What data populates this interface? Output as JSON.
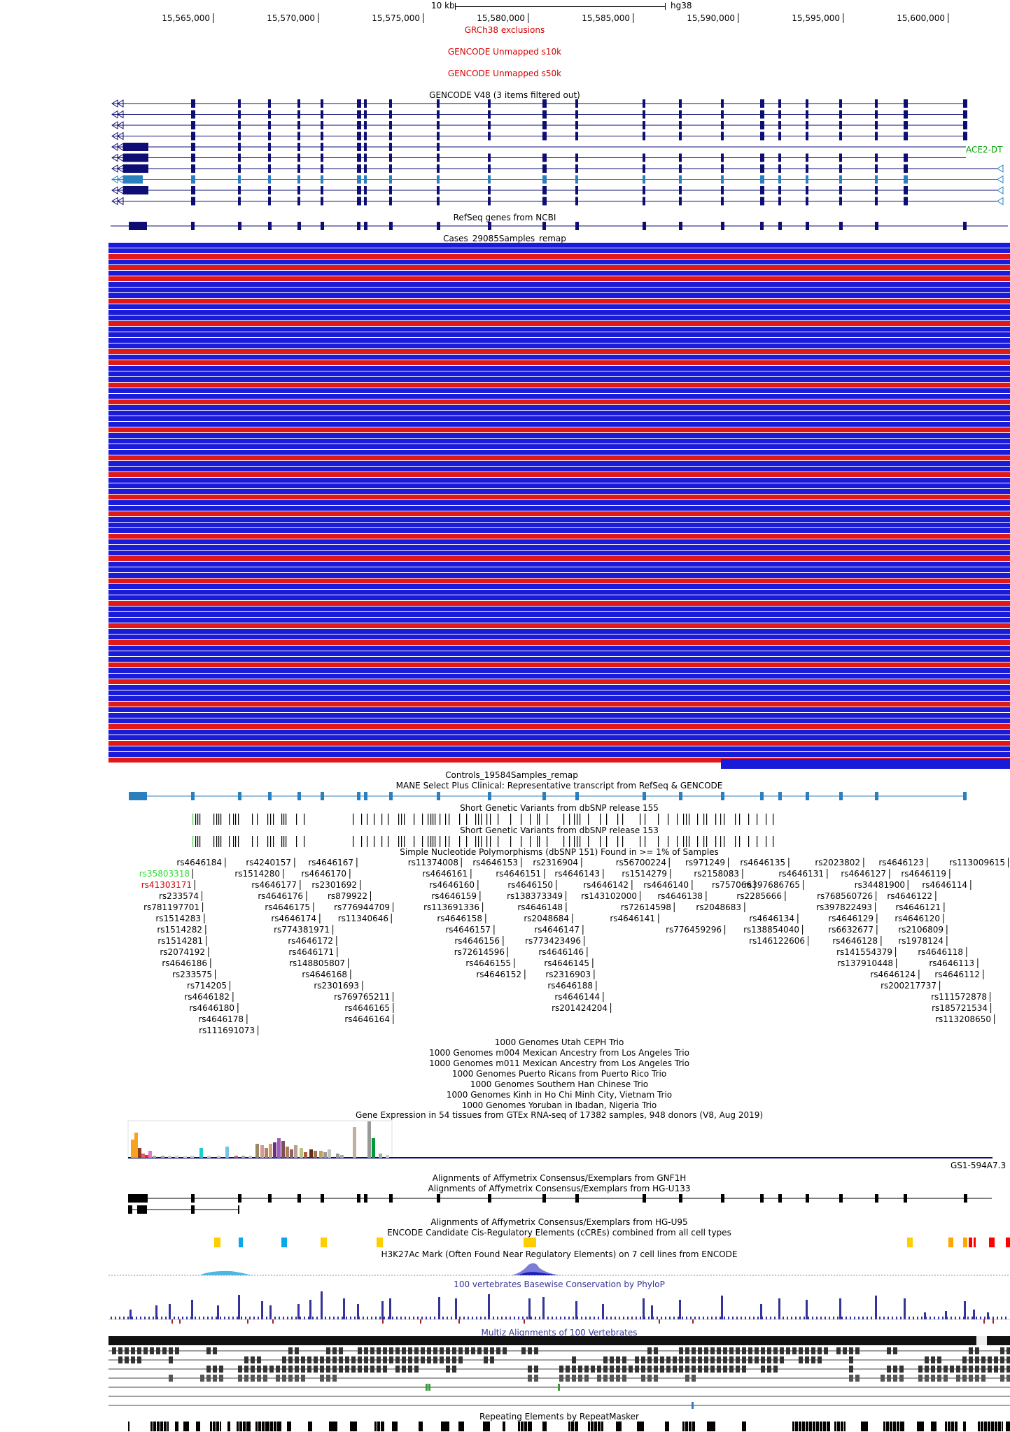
{
  "ruler": {
    "scale_label": "10 kb",
    "assembly": "hg38",
    "ticks": [
      "15,565,000",
      "15,570,000",
      "15,575,000",
      "15,580,000",
      "15,585,000",
      "15,590,000",
      "15,595,000",
      "15,600,000"
    ]
  },
  "tracks": {
    "grch38_exclusions": "GRCh38 exclusions",
    "unmapped_s10k": "GENCODE Unmapped s10k",
    "unmapped_s50k": "GENCODE Unmapped s50k",
    "gencode": "GENCODE V48 (3 items filtered out)",
    "gencode_side_label": "ACE2-DT",
    "refseq": "RefSeq genes from NCBI",
    "cases": "Cases_29085Samples_remap",
    "controls": "Controls_19584Samples_remap",
    "mane": "MANE Select Plus Clinical: Representative transcript from RefSeq & GENCODE",
    "dbsnp155": "Short Genetic Variants from dbSNP release 155",
    "dbsnp153": "Short Genetic Variants from dbSNP release 153",
    "snp151": "Simple Nucleotide Polymorphisms (dbSNP 151) Found in >= 1% of Samples",
    "trio_ceph": "1000 Genomes Utah CEPH Trio",
    "trio_m004": "1000 Genomes m004 Mexican Ancestry from Los Angeles Trio",
    "trio_m011": "1000 Genomes m011 Mexican Ancestry from Los Angeles Trio",
    "trio_pr": "1000 Genomes Puerto Ricans from Puerto Rico Trio",
    "trio_han": "1000 Genomes Southern Han Chinese Trio",
    "trio_kinh": "1000 Genomes Kinh in Ho Chi Minh City, Vietnam Trio",
    "trio_yoruba": "1000 Genomes Yoruban in Ibadan, Nigeria Trio",
    "gtex": "Gene Expression in 54 tissues from GTEx RNA-seq of 17382 samples, 948 donors (V8, Aug 2019)",
    "gtex_gene": "GS1-594A7.3",
    "gnf1h": "Alignments of Affymetrix Consensus/Exemplars from GNF1H",
    "hgu133": "Alignments of Affymetrix Consensus/Exemplars from HG-U133",
    "hgu95": "Alignments of Affymetrix Consensus/Exemplars from HG-U95",
    "encode_ccre": "ENCODE Candidate Cis-Regulatory Elements (cCREs) combined from all cell types",
    "h3k27ac": "H3K27Ac Mark (Often Found Near Regulatory Elements) on 7 cell lines from ENCODE",
    "phylop": "100 vertebrates Basewise Conservation by PhyloP",
    "multiz": "Multiz Alignments of 100 Vertebrates",
    "repeatmasker": "Repeating Elements by RepeatMasker"
  },
  "snps": [
    {
      "id": "rs4646184"
    },
    {
      "id": "rs35803318"
    },
    {
      "id": "rs41303171"
    },
    {
      "id": "rs233574"
    },
    {
      "id": "rs781197701"
    },
    {
      "id": "rs1514283"
    },
    {
      "id": "rs1514282"
    },
    {
      "id": "rs1514281"
    },
    {
      "id": "rs2074192"
    },
    {
      "id": "rs4646186"
    },
    {
      "id": "rs233575"
    },
    {
      "id": "rs714205"
    },
    {
      "id": "rs4646182"
    },
    {
      "id": "rs4646180"
    },
    {
      "id": "rs4646178"
    },
    {
      "id": "rs111691073"
    },
    {
      "id": "rs4240157"
    },
    {
      "id": "rs1514280"
    },
    {
      "id": "rs4646177"
    },
    {
      "id": "rs4646176"
    },
    {
      "id": "rs4646175"
    },
    {
      "id": "rs4646174"
    },
    {
      "id": "rs774381971"
    },
    {
      "id": "rs4646172"
    },
    {
      "id": "rs4646171"
    },
    {
      "id": "rs148805807"
    },
    {
      "id": "rs4646168"
    },
    {
      "id": "rs2301693"
    },
    {
      "id": "rs4646167"
    },
    {
      "id": "rs4646170"
    },
    {
      "id": "rs2301692"
    },
    {
      "id": "rs879922"
    },
    {
      "id": "rs776944709"
    },
    {
      "id": "rs11340646"
    },
    {
      "id": "rs769765211"
    },
    {
      "id": "rs4646165"
    },
    {
      "id": "rs4646164"
    },
    {
      "id": "rs11374008"
    },
    {
      "id": "rs4646161"
    },
    {
      "id": "rs4646160"
    },
    {
      "id": "rs4646159"
    },
    {
      "id": "rs113691336"
    },
    {
      "id": "rs4646158"
    },
    {
      "id": "rs4646157"
    },
    {
      "id": "rs4646156"
    },
    {
      "id": "rs72614596"
    },
    {
      "id": "rs4646155"
    },
    {
      "id": "rs4646152"
    },
    {
      "id": "rs4646153"
    },
    {
      "id": "rs4646151"
    },
    {
      "id": "rs4646150"
    },
    {
      "id": "rs138373349"
    },
    {
      "id": "rs4646148"
    },
    {
      "id": "rs2048684"
    },
    {
      "id": "rs4646147"
    },
    {
      "id": "rs773423496"
    },
    {
      "id": "rs4646146"
    },
    {
      "id": "rs4646145"
    },
    {
      "id": "rs2316903"
    },
    {
      "id": "rs4646188"
    },
    {
      "id": "rs4646144"
    },
    {
      "id": "rs201424204"
    },
    {
      "id": "rs2316904"
    },
    {
      "id": "rs4646143"
    },
    {
      "id": "rs4646142"
    },
    {
      "id": "rs143102000"
    },
    {
      "id": "rs72614598"
    },
    {
      "id": "rs4646141"
    },
    {
      "id": "rs56700224"
    },
    {
      "id": "rs1514279"
    },
    {
      "id": "rs4646140"
    },
    {
      "id": "rs4646138"
    },
    {
      "id": "rs776459296"
    },
    {
      "id": "rs971249"
    },
    {
      "id": "rs2158083"
    },
    {
      "id": "rs757066"
    },
    {
      "id": "rs2048683"
    },
    {
      "id": "rs4646135"
    },
    {
      "id": "rs397686765"
    },
    {
      "id": "rs2285666"
    },
    {
      "id": "rs4646134"
    },
    {
      "id": "rs138854040"
    },
    {
      "id": "rs146122606"
    },
    {
      "id": "rs2023802"
    },
    {
      "id": "rs4646131"
    },
    {
      "id": "rs34481900"
    },
    {
      "id": "rs768560726"
    },
    {
      "id": "rs397822493"
    },
    {
      "id": "rs4646129"
    },
    {
      "id": "rs6632677"
    },
    {
      "id": "rs4646128"
    },
    {
      "id": "rs141554379"
    },
    {
      "id": "rs137910448"
    },
    {
      "id": "rs4646124"
    },
    {
      "id": "rs200217737"
    },
    {
      "id": "rs4646123"
    },
    {
      "id": "rs4646127"
    },
    {
      "id": "rs4646119"
    },
    {
      "id": "rs4646122"
    },
    {
      "id": "rs4646121"
    },
    {
      "id": "rs4646120"
    },
    {
      "id": "rs2106809"
    },
    {
      "id": "rs1978124"
    },
    {
      "id": "rs4646118"
    },
    {
      "id": "rs4646113"
    },
    {
      "id": "rs4646112"
    },
    {
      "id": "rs113009615"
    },
    {
      "id": "rs4646114"
    },
    {
      "id": "rs111572878"
    },
    {
      "id": "rs185721534"
    },
    {
      "id": "rs113208650"
    }
  ],
  "colors": {
    "gene_dark": "#0d0d73",
    "gene_light": "#2a7fbf",
    "case_blue": "#1a1ad9",
    "case_red": "#e01818",
    "track_title_red": "#d40000",
    "phylop_title": "#33339a"
  }
}
